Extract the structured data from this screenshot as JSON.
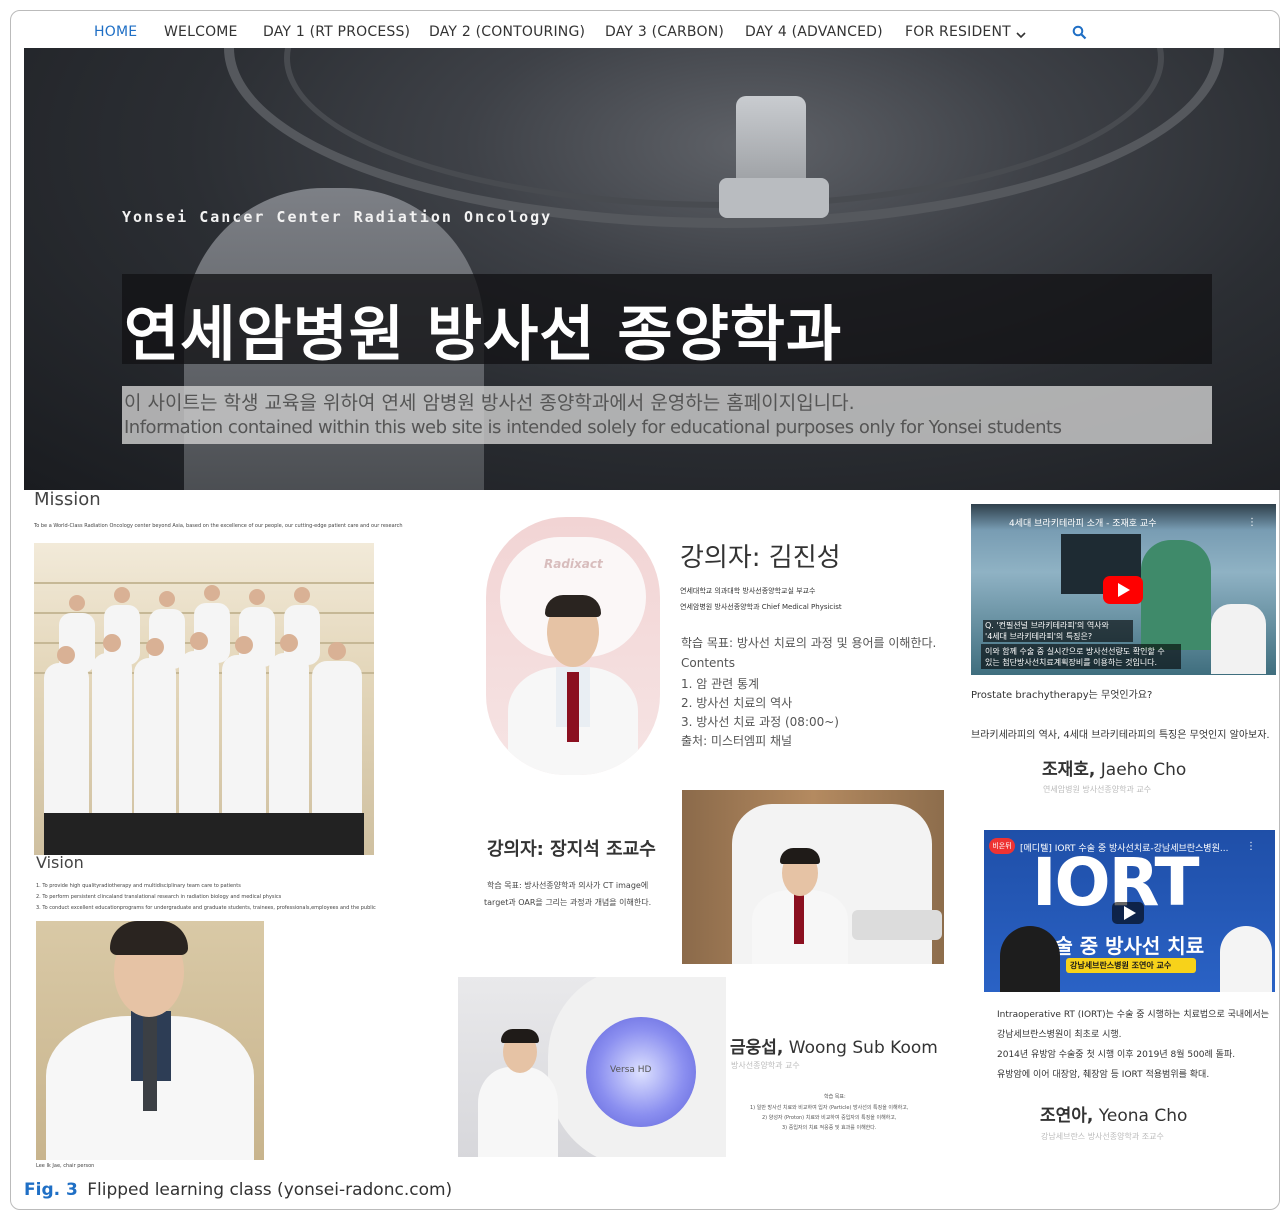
{
  "nav": {
    "items": [
      "HOME",
      "WELCOME",
      "DAY 1 (RT PROCESS)",
      "DAY 2 (CONTOURING)",
      "DAY 3 (CARBON)",
      "DAY 4 (ADVANCED)",
      "FOR RESIDENT"
    ],
    "dropdown_icon": "chevron-down-icon",
    "search_icon": "search-icon",
    "active_color": "#1f6fc5"
  },
  "hero": {
    "subtitle": "Yonsei Cancer Center Radiation Oncology",
    "title": "연세암병원 방사선 종양학과",
    "info_ko": "이 사이트는 학생 교육을 위하여 연세 암병원 방사선 종양학과에서 운영하는 홈페이지입니다.",
    "info_en": "Information contained within this web site is intended solely for educational purposes only for Yonsei students"
  },
  "mission": {
    "heading": "Mission",
    "text": "To be a World-Class Radiation Oncology center beyond Asia, based on the excellence of our people, our cutting-edge patient care and our research"
  },
  "vision": {
    "heading": "Vision",
    "items": [
      "1. To provide high qualityradiotherapy and multidisciplinary team care to patients",
      "2. To perform persistent clincaland translational research in radiation biology and medical physics",
      "3. To conduct excellent educationprograms for undergraduate and graduate students, trainees, professionals,employees and the public"
    ],
    "chair_caption": "Lee Ik Jae, chair person"
  },
  "lecture1": {
    "title": "강의자: 김진성",
    "affil1": "연세대학교 의과대학 방사선종양학교실 부교수",
    "affil2": "연세암병원 방사선종양학과 Chief Medical Physicist",
    "goal": "학습 목표: 방사선 치료의 과정 및 용어를 이해한다.",
    "contents_label": "Contents",
    "contents": [
      "1. 암 관련 통계",
      "2. 방사선 치료의 역사",
      "3. 방사선 치료 과정 (08:00~)",
      "출처: 미스터엠피 채널"
    ],
    "machine_label": "Radixact"
  },
  "lecture2": {
    "title": "강의자: 장지석 조교수",
    "goal_line1": "학습 목표: 방사선종양학과 의사가 CT image에",
    "goal_line2": "target과 OAR을 그리는 과정과 개념을 이해한다."
  },
  "lecture3": {
    "name_ko": "금웅섭,",
    "name_en": "Woong Sub Koom",
    "affil": "방사선종양학과 교수",
    "goal_label": "학습 목표:",
    "goals": [
      "1) 일반 방사선 치료와 비교하여 입자 (Particle) 방사선의 특징을 이해하고,",
      "2) 양성자 (Proton) 치료와 비교하여 중입자의 특징을 이해하고,",
      "3) 중입자의 치료 적응증 및 효과를 이해한다."
    ],
    "machine_label": "Versa HD"
  },
  "video1": {
    "title": "4세대 브라키테라피 소개 - 조재호 교수",
    "caption_line1": "Q. '컨필션널 브라키테라피'의 역사와",
    "caption_line2": "'4세대 브라키테라피'의 특징은?",
    "sub_line1": "이와 함께 수술 중 실시간으로 방사선선량도 확인할 수",
    "sub_line2": "있는 첨단방사선치료계획장비를 이용하는 것입니다.",
    "desc1": "Prostate brachytherapy는 무엇인가요?",
    "desc2": "브라키세라피의 역사, 4세대 브라키테라피의 특징은 무엇인지 알아보자.",
    "name_ko": "조재호,",
    "name_en": "Jaeho Cho",
    "affil": "연세암병원 방사선종양학과 교수"
  },
  "video2": {
    "badge": "비온뒤",
    "title": "[메디텔] IORT 수술 중 방사선치료-강남세브란스병원...",
    "big": "IORT",
    "band": "수술 중 방사선 치료",
    "sub": "강남세브란스병원 조연아 교수",
    "desc": [
      "Intraoperative RT (IORT)는 수술 중 시행하는 치료법으로 국내에서는",
      "강남세브란스병원이 최초로 시행.",
      "2014년 유방암 수술중 첫 시행 이후 2019년 8월 500례 돌파.",
      "유방암에 이어 대장암, 췌장암 등 IORT 적용범위를 확대."
    ],
    "name_ko": "조연아,",
    "name_en": "Yeona Cho",
    "affil": "강남세브란스 방사선종양학과 조교수"
  },
  "figure": {
    "label": "Fig. 3",
    "caption": "Flipped learning class (yonsei-radonc.com)"
  }
}
